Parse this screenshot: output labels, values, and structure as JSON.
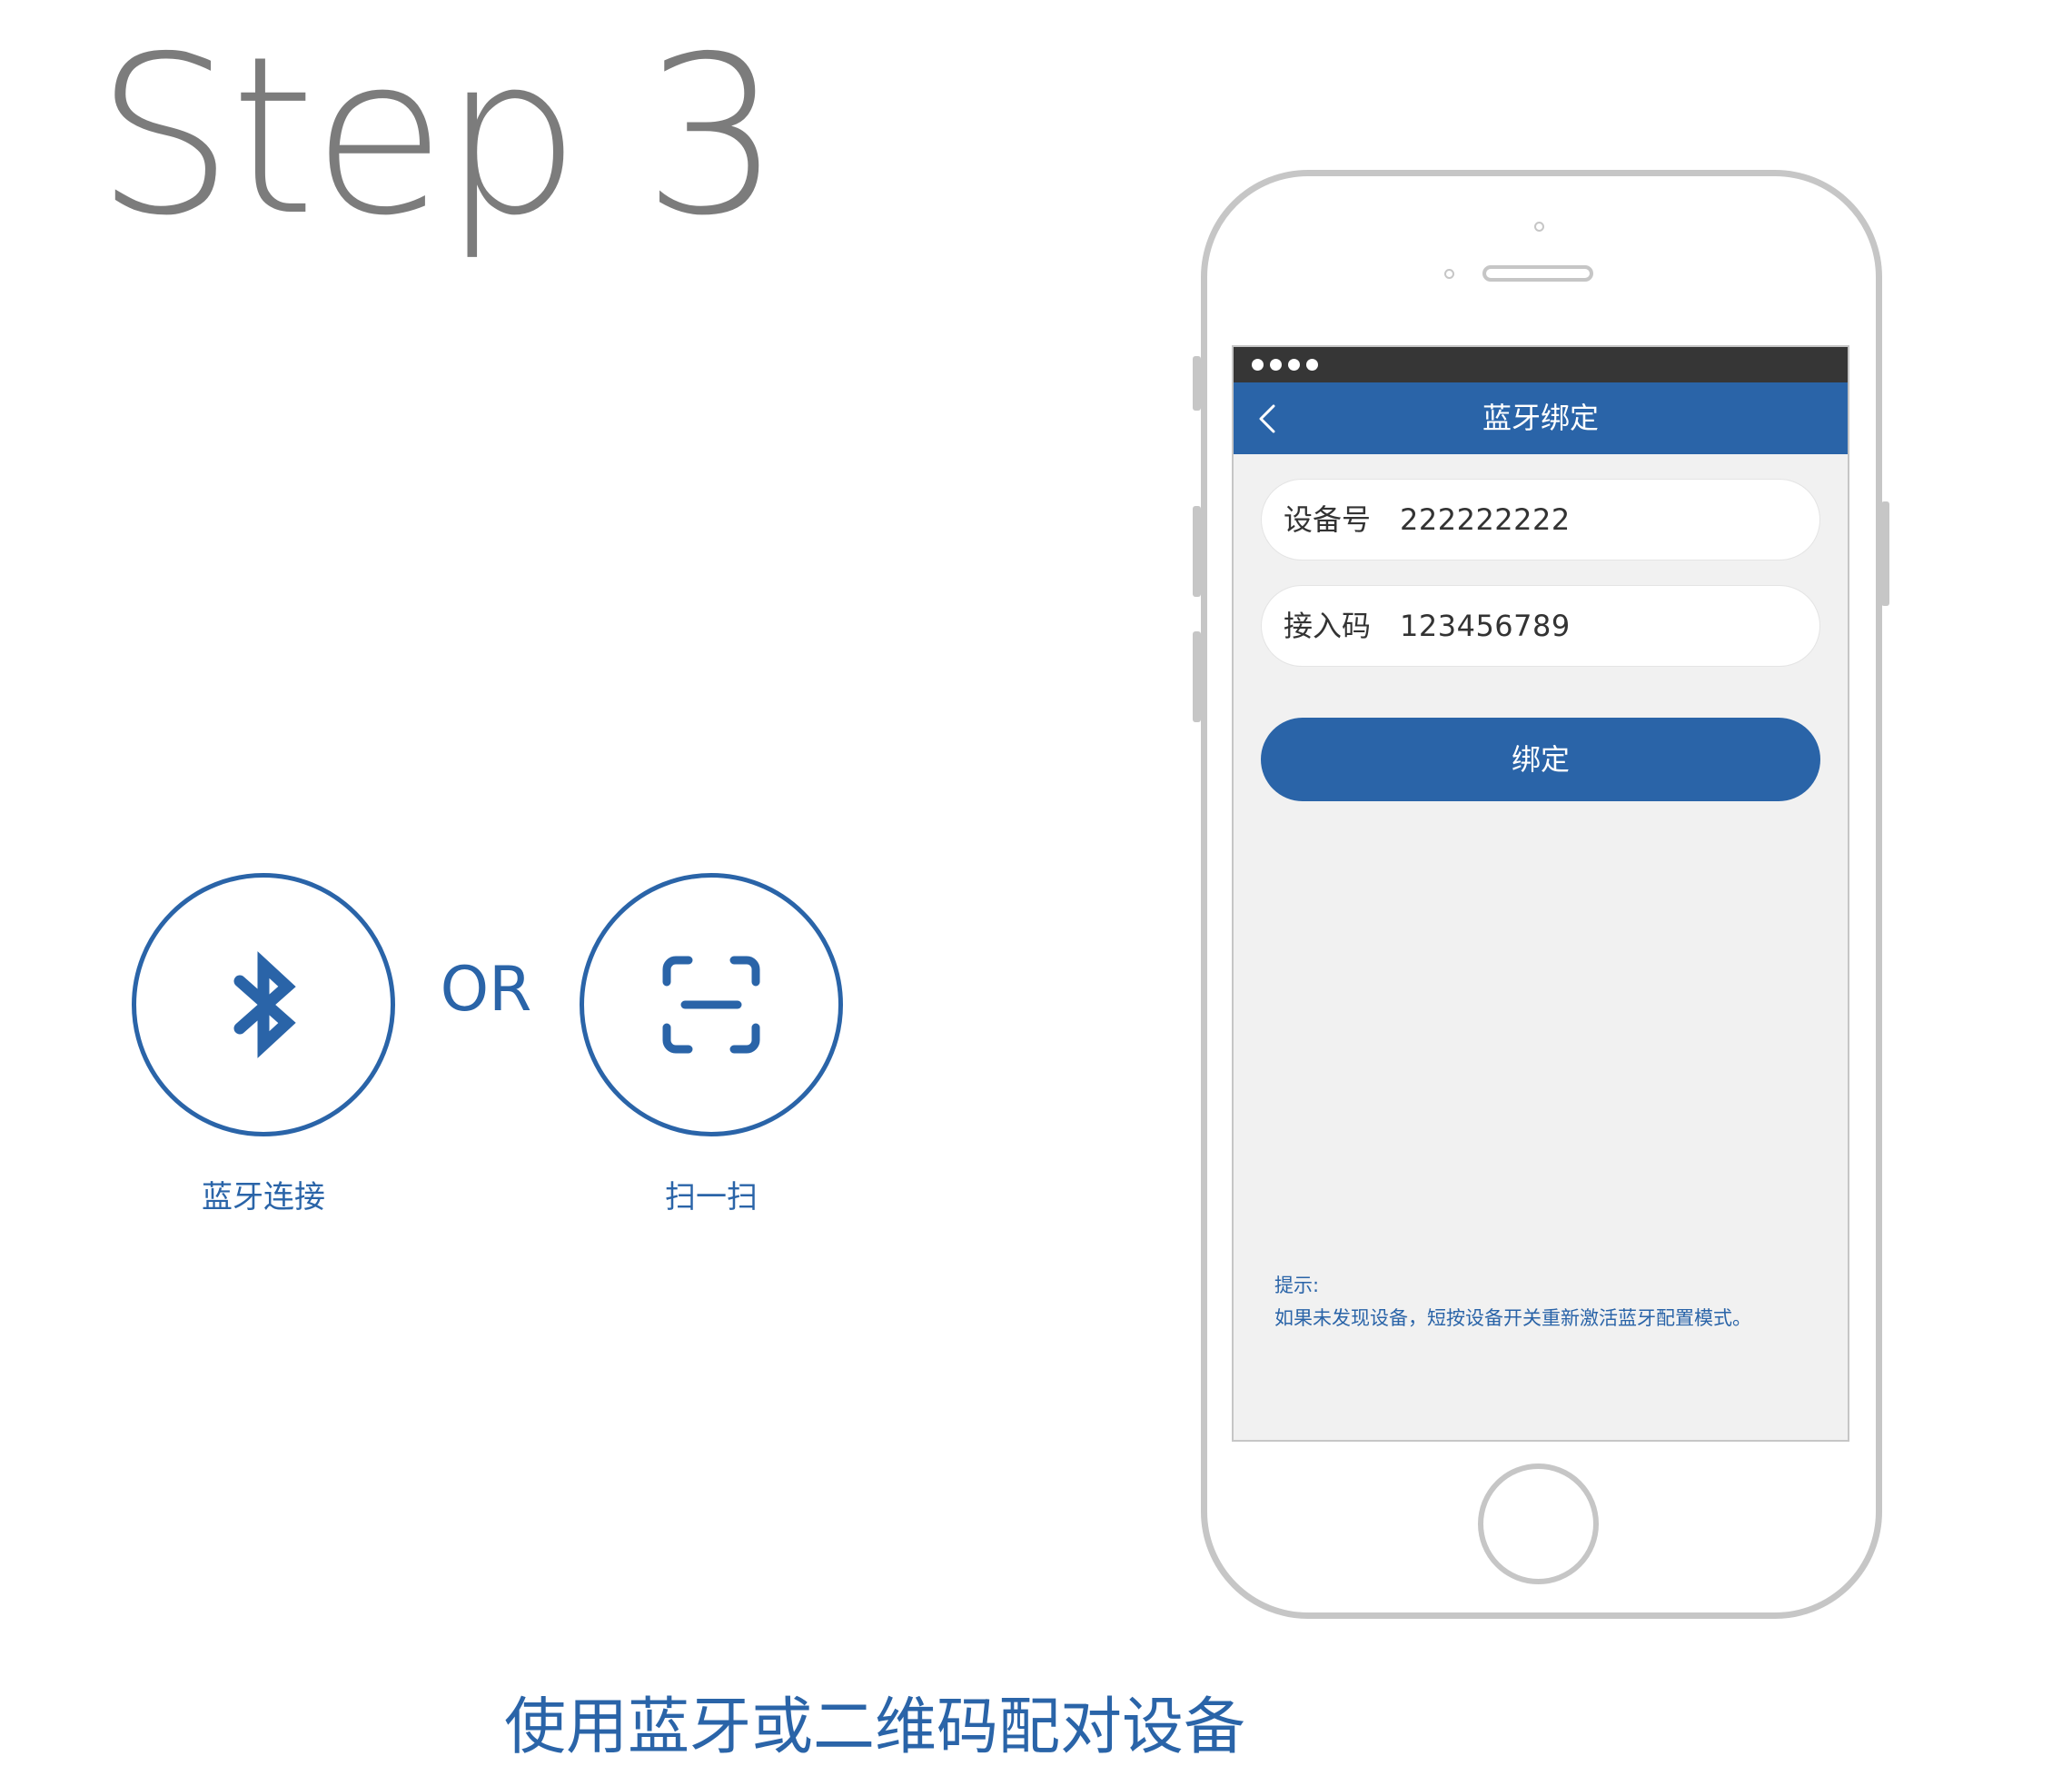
{
  "step": {
    "title": "Step 3"
  },
  "options": {
    "bluetooth": {
      "icon": "bluetooth-icon",
      "label": "蓝牙连接"
    },
    "separator": "OR",
    "scan": {
      "icon": "scan-icon",
      "label": "扫一扫"
    }
  },
  "caption": "使用蓝牙或二维码配对设备",
  "phone": {
    "nav": {
      "back_icon": "chevron-left-icon",
      "title": "蓝牙绑定"
    },
    "form": {
      "device": {
        "label": "设备号",
        "value": "222222222"
      },
      "access": {
        "label": "接入码",
        "value": "123456789"
      },
      "bind_label": "绑定"
    },
    "tip": {
      "title": "提示:",
      "text": "如果未发现设备，短按设备开关重新激活蓝牙配置模式。"
    }
  },
  "colors": {
    "accent": "#2a64a8",
    "title_gray": "#7c7c7c",
    "frame_gray": "#c6c6c6",
    "status_bar": "#363636",
    "screen_bg": "#f1f1f1"
  }
}
